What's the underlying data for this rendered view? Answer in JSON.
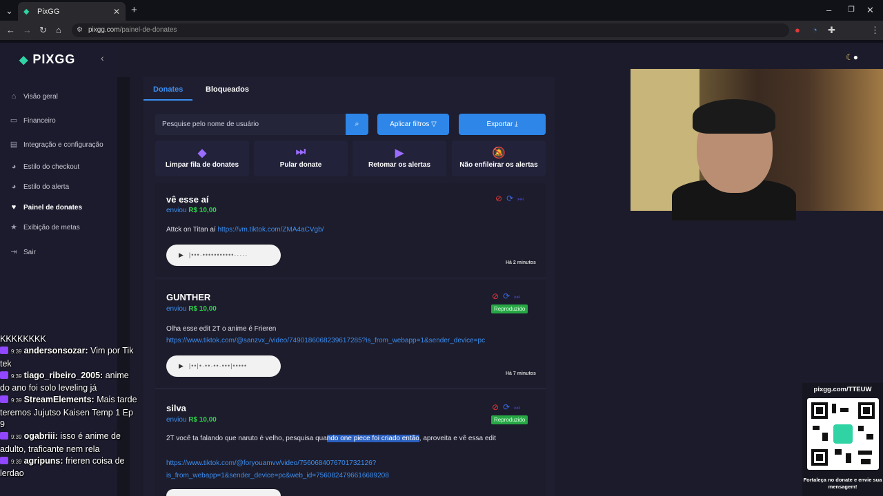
{
  "browser": {
    "tab_title": "PixGG",
    "url_domain": "pixgg.com",
    "url_path": "/painel-de-donates",
    "profile_initial": "M"
  },
  "sidebar": {
    "logo": "PIXGG",
    "items": [
      {
        "label": "Visão geral",
        "icon": "home-icon"
      },
      {
        "label": "Financeiro",
        "icon": "wallet-icon"
      },
      {
        "label": "Integração e configuração",
        "icon": "settings-icon"
      },
      {
        "label": "Estilo do checkout",
        "icon": "palette-icon"
      },
      {
        "label": "Estilo do alerta",
        "icon": "palette-icon"
      },
      {
        "label": "Painel de donates",
        "icon": "donate-icon"
      },
      {
        "label": "Exibição de metas",
        "icon": "star-icon"
      },
      {
        "label": "Sair",
        "icon": "logout-icon"
      }
    ]
  },
  "tabs": {
    "donates": "Donates",
    "bloqueados": "Bloqueados"
  },
  "toolbar": {
    "search_placeholder": "Pesquise pelo nome de usuário",
    "filters_label": "Aplicar filtros",
    "export_label": "Exportar"
  },
  "actions": [
    {
      "label": "Limpar fila de donates",
      "icon": "eraser-icon"
    },
    {
      "label": "Pular donate",
      "icon": "skip-icon"
    },
    {
      "label": "Retomar os alertas",
      "icon": "play-icon"
    },
    {
      "label": "Não enfileirar os alertas",
      "icon": "bell-off-icon"
    }
  ],
  "donates": [
    {
      "name": "vê esse aí",
      "sent_label": "enviou",
      "amount": "R$ 10,00",
      "message": "Attck on Titan aí ",
      "link": "https://vm.tiktok.com/ZMA4aCVgb/",
      "time": "Há 2 minutos",
      "badge": ""
    },
    {
      "name": "GUNTHER",
      "sent_label": "enviou",
      "amount": "R$ 10,00",
      "message": "Olha esse edit 2T o anime é Frieren",
      "link": "https://www.tiktok.com/@sanzvx_/video/7490186068239617285?is_from_webapp=1&sender_device=pc",
      "time": "Há 7 minutos",
      "badge": "Reproduzido"
    },
    {
      "name": "silva",
      "sent_label": "enviou",
      "amount": "R$ 10,00",
      "message_pre": "2T você ta falando que naruto é velho, pesquisa qua",
      "message_hl": "ndo one piece foi criado então",
      "message_post": ", aproveita e vê essa edit",
      "link_line1": "https://www.tiktok.com/@foryouamvv/video/7560684076701732126?",
      "link_line2": "is_from_webapp=1&sender_device=pc&web_id=7560824796616689208",
      "badge": "Reproduzido"
    }
  ],
  "chat": {
    "first": "KKKKKKKK",
    "lines": [
      {
        "time": "9:39",
        "user": "andersonsozar:",
        "text": "Vim por Tik tek"
      },
      {
        "time": "9:39",
        "user": "tiago_ribeiro_2005:",
        "text": "anime do ano foi solo leveling já"
      },
      {
        "time": "9:39",
        "user": "StreamElements:",
        "text": "Mais tarde teremos Jujutso Kaisen Temp 1 Ep 9"
      },
      {
        "time": "9:39",
        "user": "ogabriii:",
        "text": "isso é anime de adulto, traficante nem rela"
      },
      {
        "time": "9:39",
        "user": "agripuns:",
        "text": "frieren coisa de lerdao"
      }
    ]
  },
  "qr_widget": {
    "url": "pixgg.com/TTEUW",
    "caption": "Fortaleça no donate e envie sua mensagem!"
  },
  "colors": {
    "accent": "#2d86e8",
    "brand": "#2fd3a4",
    "amount": "#2fd34a",
    "ban": "#e03a3a"
  }
}
